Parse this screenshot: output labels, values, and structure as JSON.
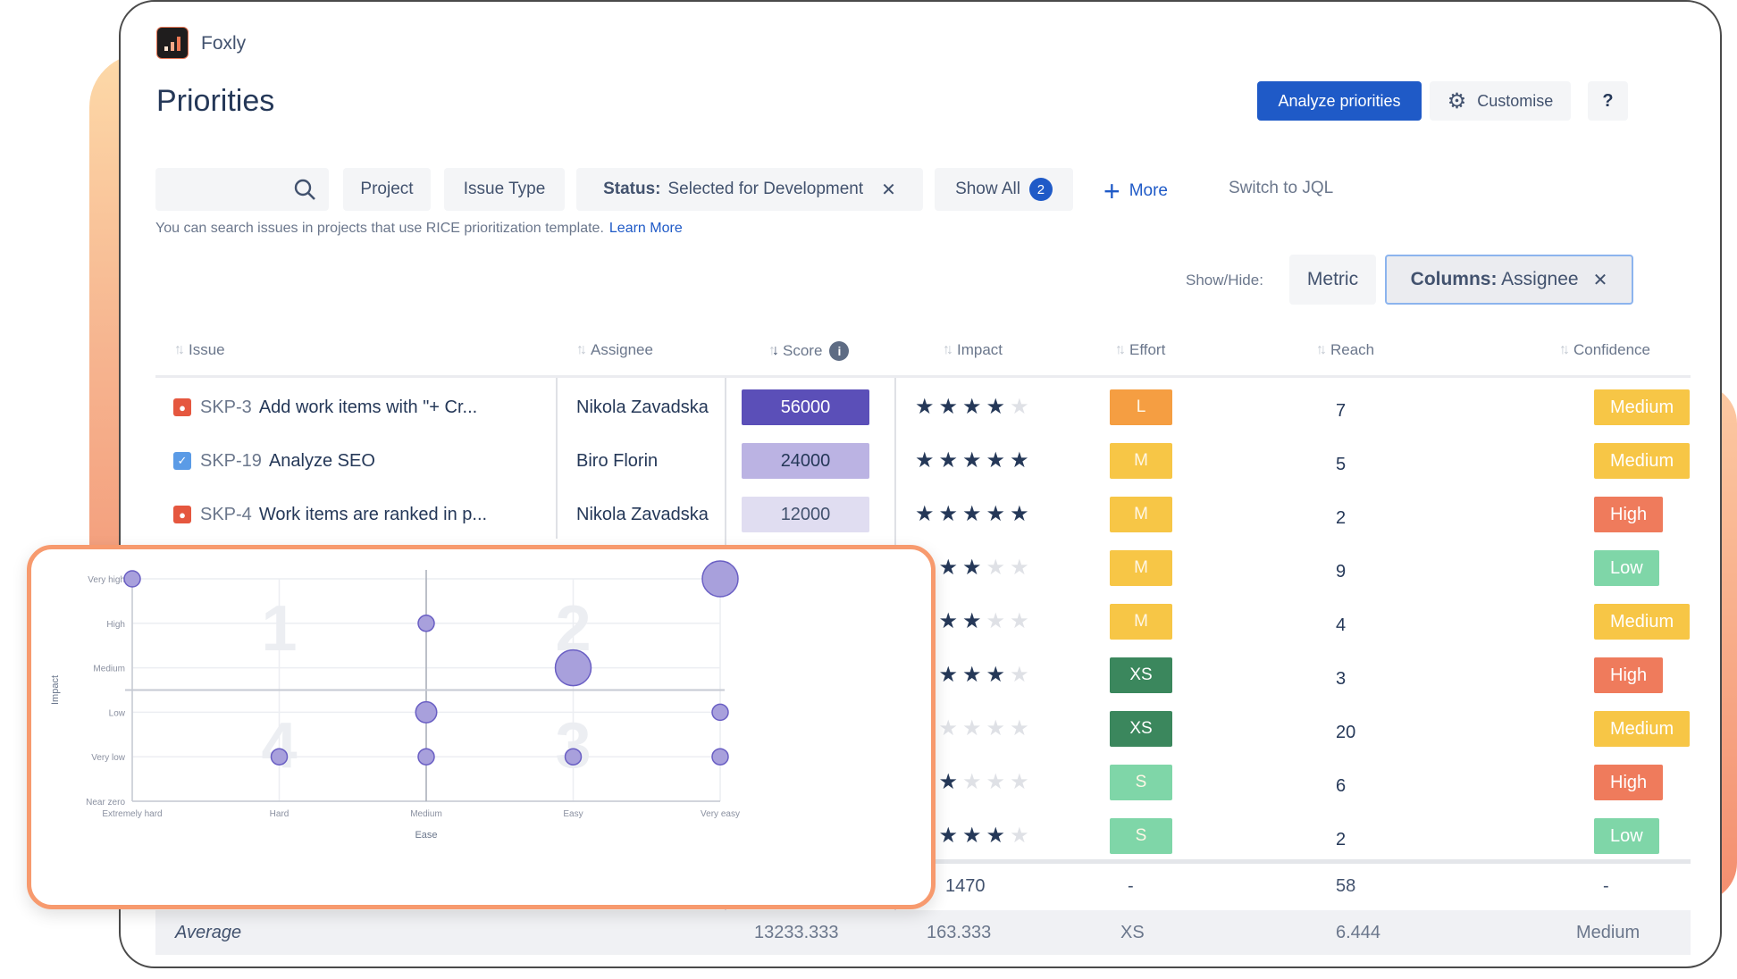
{
  "app": {
    "name": "Foxly",
    "page_title": "Priorities"
  },
  "actions": {
    "analyze": "Analyze priorities",
    "customise": "Customise",
    "help": "?"
  },
  "filters": {
    "search_placeholder": "",
    "project": "Project",
    "issue_type": "Issue Type",
    "status_label": "Status:",
    "status_value": "Selected for Development",
    "show_all": "Show All",
    "show_all_count": "2",
    "more": "More",
    "switch_jql": "Switch to JQL",
    "help_text": "You can search issues in projects that use RICE prioritization template.",
    "learn_more": "Learn More"
  },
  "show_hide": {
    "label": "Show/Hide:",
    "metric": "Metric",
    "columns_label": "Columns:",
    "columns_value": "Assignee"
  },
  "table": {
    "headers": {
      "issue": "Issue",
      "assignee": "Assignee",
      "score": "Score",
      "impact": "Impact",
      "effort": "Effort",
      "reach": "Reach",
      "confidence": "Confidence"
    },
    "rows": [
      {
        "type": "bug",
        "key": "SKP-3",
        "summary": "Add work items with \"+ Cr...",
        "assignee": "Nikola Zavadska",
        "score": "56000",
        "impact": 4,
        "effort": "L",
        "reach": "7",
        "confidence": "Medium"
      },
      {
        "type": "task",
        "key": "SKP-19",
        "summary": "Analyze SEO",
        "assignee": "Biro Florin",
        "score": "24000",
        "impact": 5,
        "effort": "M",
        "reach": "5",
        "confidence": "Medium"
      },
      {
        "type": "bug",
        "key": "SKP-4",
        "summary": "Work items are ranked in p...",
        "assignee": "Nikola Zavadska",
        "score": "12000",
        "impact": 5,
        "effort": "M",
        "reach": "2",
        "confidence": "High"
      },
      {
        "impact": 3,
        "effort": "M",
        "reach": "9",
        "confidence": "Low"
      },
      {
        "impact": 3,
        "effort": "M",
        "reach": "4",
        "confidence": "Medium"
      },
      {
        "impact": 4,
        "effort": "XS",
        "reach": "3",
        "confidence": "High"
      },
      {
        "impact": 1,
        "effort": "XS",
        "reach": "20",
        "confidence": "Medium"
      },
      {
        "impact": 2,
        "effort": "S",
        "reach": "6",
        "confidence": "High"
      },
      {
        "impact": 4,
        "effort": "S",
        "reach": "2",
        "confidence": "Low"
      }
    ],
    "totals": {
      "impact": "1470",
      "effort": "-",
      "reach": "58",
      "confidence": "-"
    },
    "average": {
      "label": "Average",
      "score": "13233.333",
      "impact": "163.333",
      "effort": "XS",
      "reach": "6.444",
      "confidence": "Medium"
    }
  },
  "colors": {
    "primary": "#1f5ac7",
    "score_high": "#5b4fb8",
    "score_mid": "#bbb3e3",
    "score_low": "#e0ddf1",
    "effort": {
      "L": "#f59e42",
      "M": "#f7c646",
      "XS": "#3b875d",
      "S": "#7fd6a8"
    },
    "confidence": {
      "Medium": "#f7c646",
      "High": "#ef7b5c",
      "Low": "#7fd6a8"
    },
    "bubble": "#a8a0dc",
    "bubble_stroke": "#6a5fc4"
  },
  "chart_data": {
    "type": "scatter",
    "title": "",
    "xlabel": "Ease",
    "ylabel": "Impact",
    "x_categories": [
      "Extremely hard",
      "Hard",
      "Medium",
      "Easy",
      "Very easy"
    ],
    "y_categories": [
      "Near zero",
      "Very low",
      "Low",
      "Medium",
      "High",
      "Very high"
    ],
    "quadrant_labels": [
      "1",
      "2",
      "3",
      "4"
    ],
    "points": [
      {
        "x": "Extremely hard",
        "y": "Very high",
        "size": 1
      },
      {
        "x": "Medium",
        "y": "High",
        "size": 1
      },
      {
        "x": "Easy",
        "y": "Medium",
        "size": 3
      },
      {
        "x": "Very easy",
        "y": "Very high",
        "size": 3
      },
      {
        "x": "Medium",
        "y": "Low",
        "size": 1.5
      },
      {
        "x": "Very easy",
        "y": "Low",
        "size": 1
      },
      {
        "x": "Hard",
        "y": "Very low",
        "size": 1
      },
      {
        "x": "Medium",
        "y": "Very low",
        "size": 1
      },
      {
        "x": "Easy",
        "y": "Very low",
        "size": 1
      },
      {
        "x": "Very easy",
        "y": "Very low",
        "size": 1
      }
    ],
    "grid": true
  }
}
